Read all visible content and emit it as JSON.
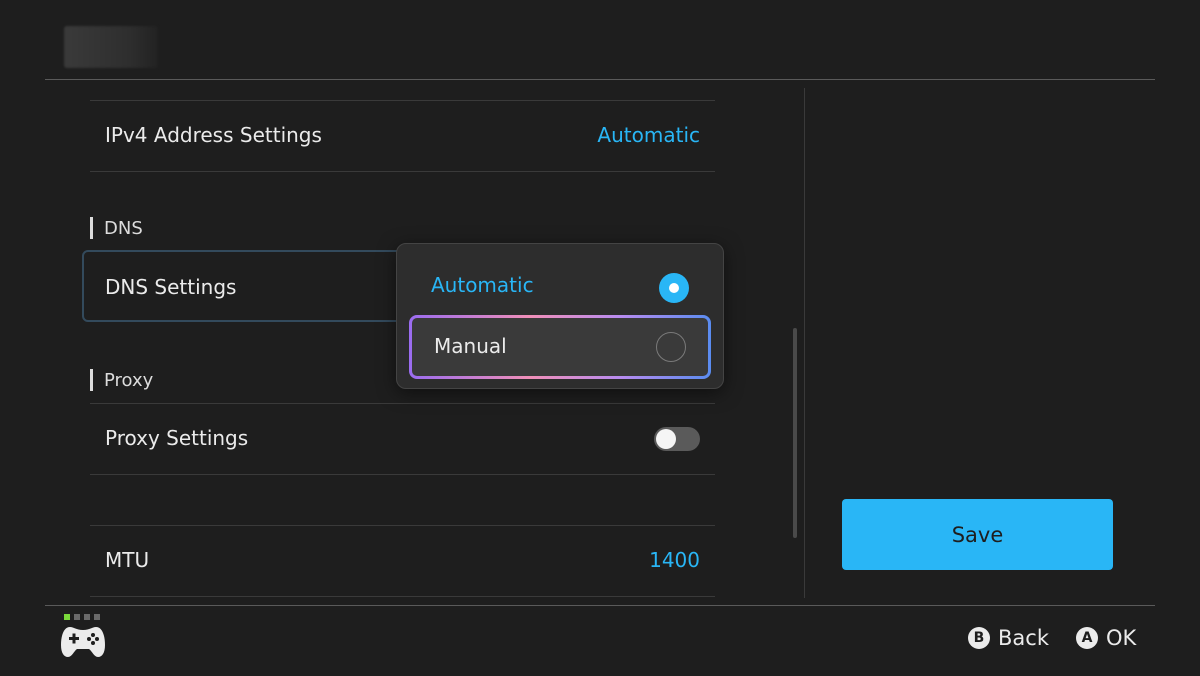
{
  "rows": {
    "ipv4": {
      "label": "IPv4 Address Settings",
      "value": "Automatic"
    },
    "dns": {
      "label": "DNS Settings"
    },
    "proxy": {
      "label": "Proxy Settings",
      "enabled": false
    },
    "mtu": {
      "label": "MTU",
      "value": "1400"
    }
  },
  "sections": {
    "dns": "DNS",
    "proxy": "Proxy"
  },
  "dns_popup": {
    "options": [
      {
        "label": "Automatic",
        "selected": true
      },
      {
        "label": "Manual",
        "selected": false
      }
    ]
  },
  "save_button": {
    "label": "Save"
  },
  "footer": {
    "back": {
      "key": "B",
      "label": "Back"
    },
    "ok": {
      "key": "A",
      "label": "OK"
    }
  },
  "colors": {
    "accent": "#29b6f6",
    "background": "#1e1e1e",
    "active_indicator": "#7ad93a"
  },
  "icons": {
    "controller": "gamepad-icon",
    "back_key": "b-button-icon",
    "ok_key": "a-button-icon"
  }
}
